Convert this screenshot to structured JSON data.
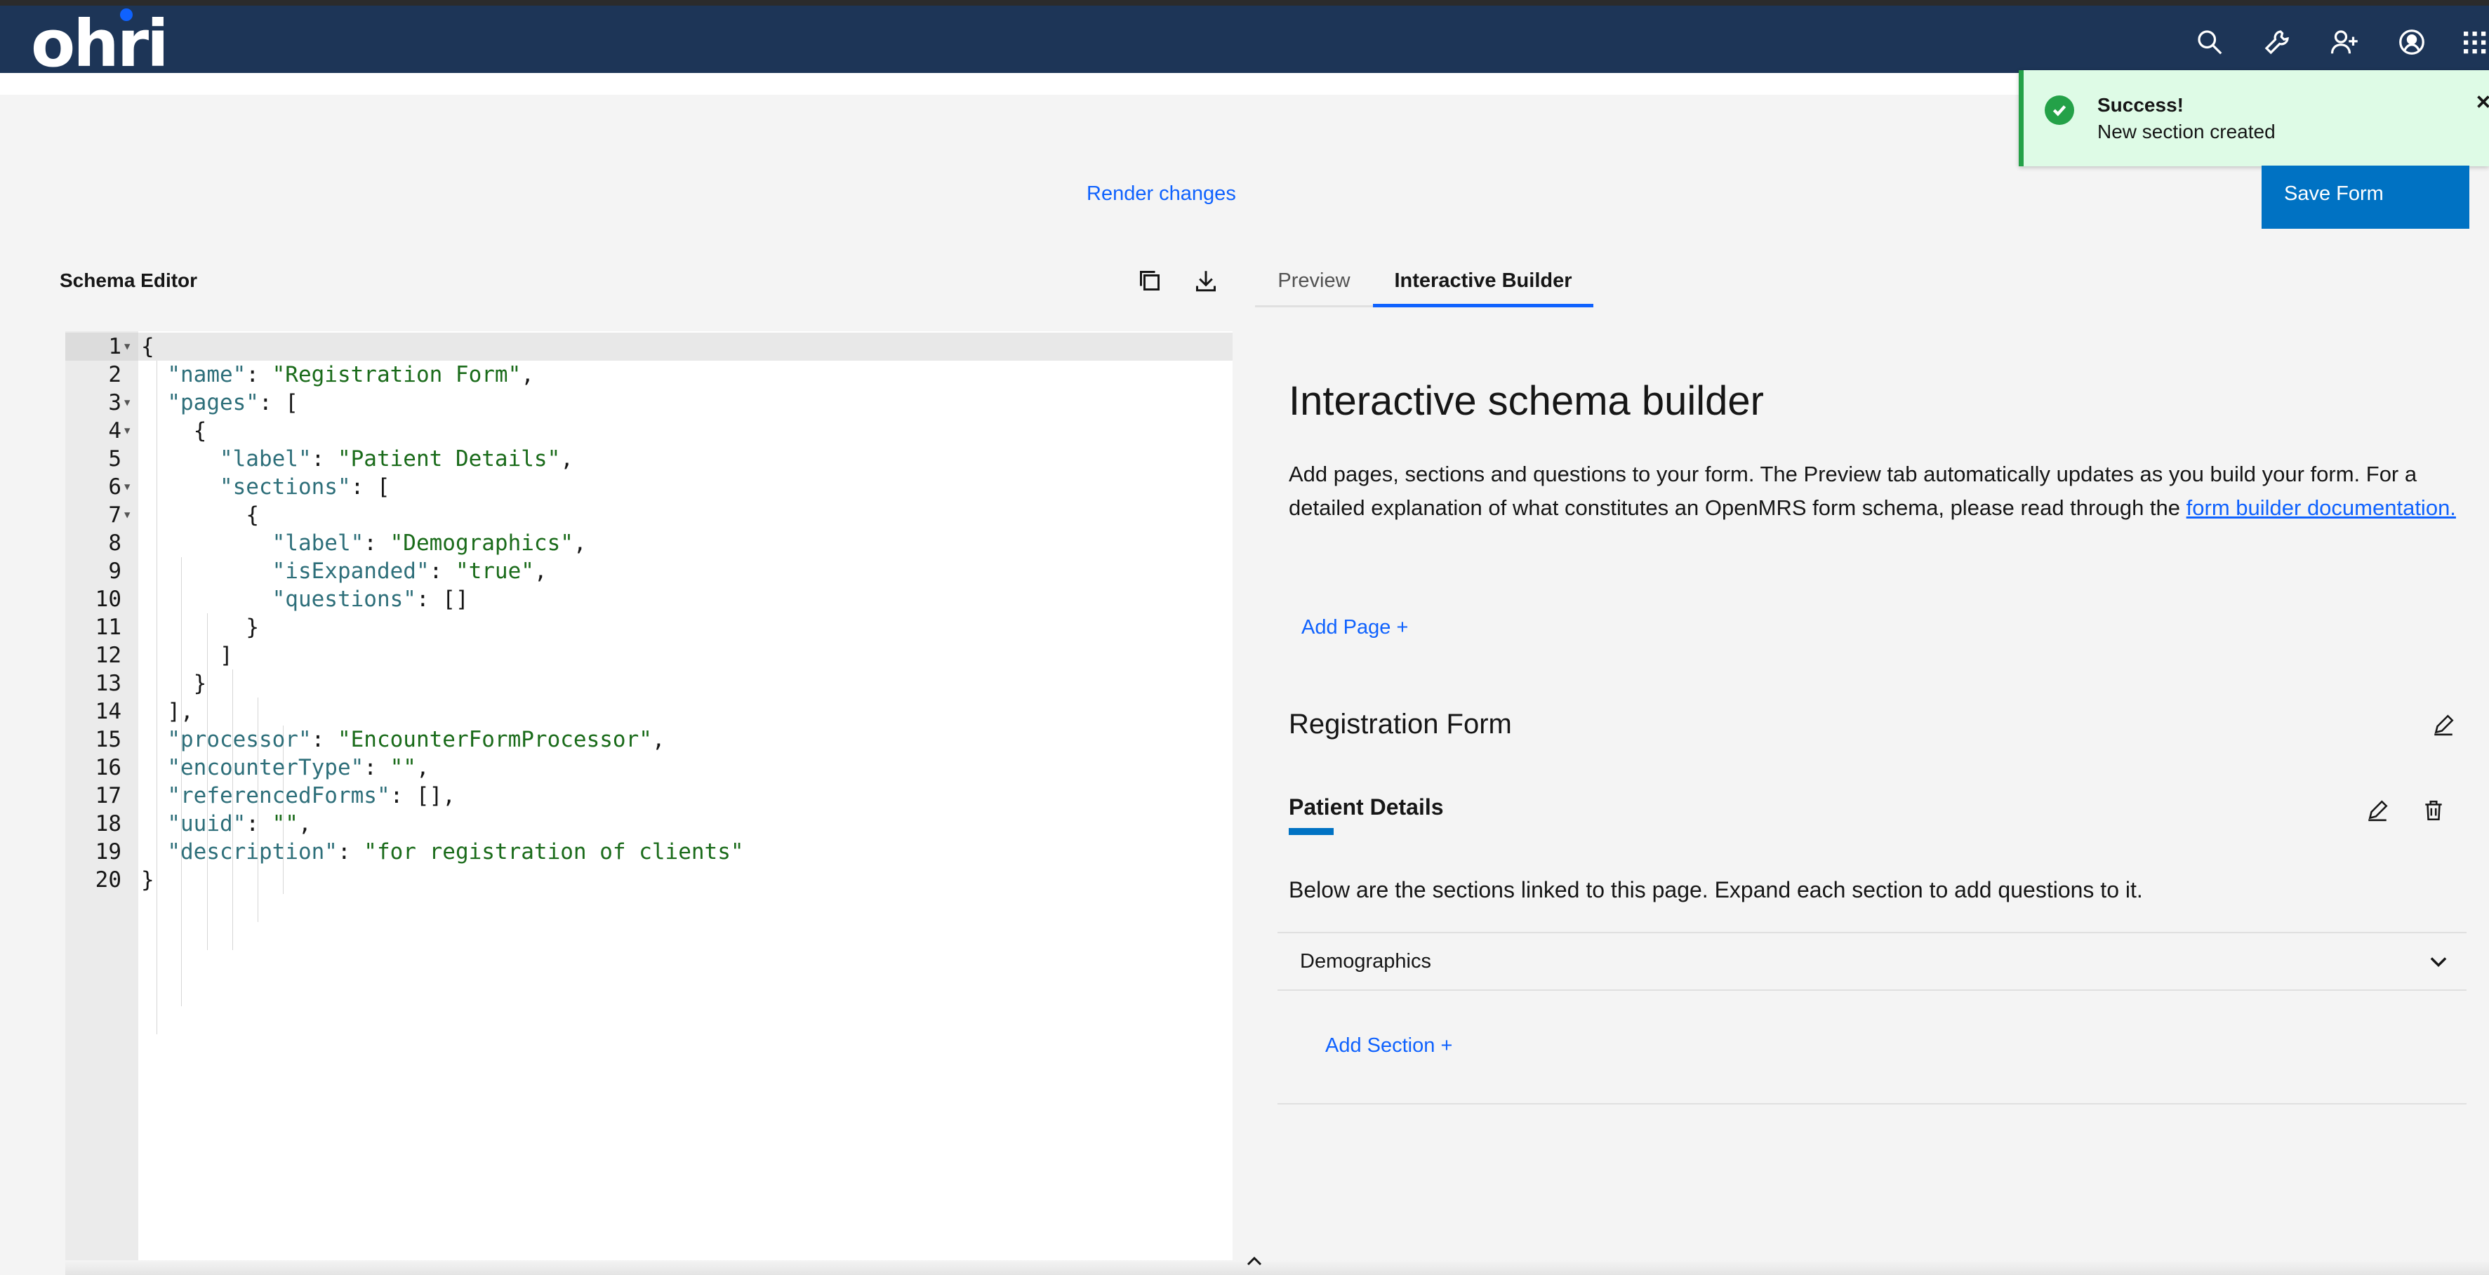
{
  "header": {
    "logo": "ohri",
    "icons": [
      "search-icon",
      "wrench-icon",
      "add-user-icon",
      "user-avatar-icon",
      "app-switcher-icon"
    ]
  },
  "toast": {
    "title": "Success!",
    "subtitle": "New section created"
  },
  "actions": {
    "render_changes": "Render changes",
    "save_form": "Save Form"
  },
  "schema_editor": {
    "title": "Schema Editor",
    "tools": [
      "copy-icon",
      "download-icon"
    ]
  },
  "tabs": {
    "preview": "Preview",
    "interactive_builder": "Interactive Builder"
  },
  "builder": {
    "heading": "Interactive schema builder",
    "description_part1": "Add pages, sections and questions to your form. The Preview tab automatically updates as you build your form. For a detailed explanation of what constitutes an OpenMRS form schema, please read through the ",
    "description_link": "form builder documentation.",
    "add_page": "Add Page",
    "form_name": "Registration Form",
    "page_label": "Patient Details",
    "sections_note": "Below are the sections linked to this page. Expand each section to add questions to it.",
    "section_label": "Demographics",
    "add_section": "Add Section"
  },
  "colors": {
    "header_bg": "#1d3557",
    "accent": "#0f62fe",
    "primary_button": "#0072c3",
    "success": "#24a148",
    "toast_bg": "#defbe6"
  }
}
